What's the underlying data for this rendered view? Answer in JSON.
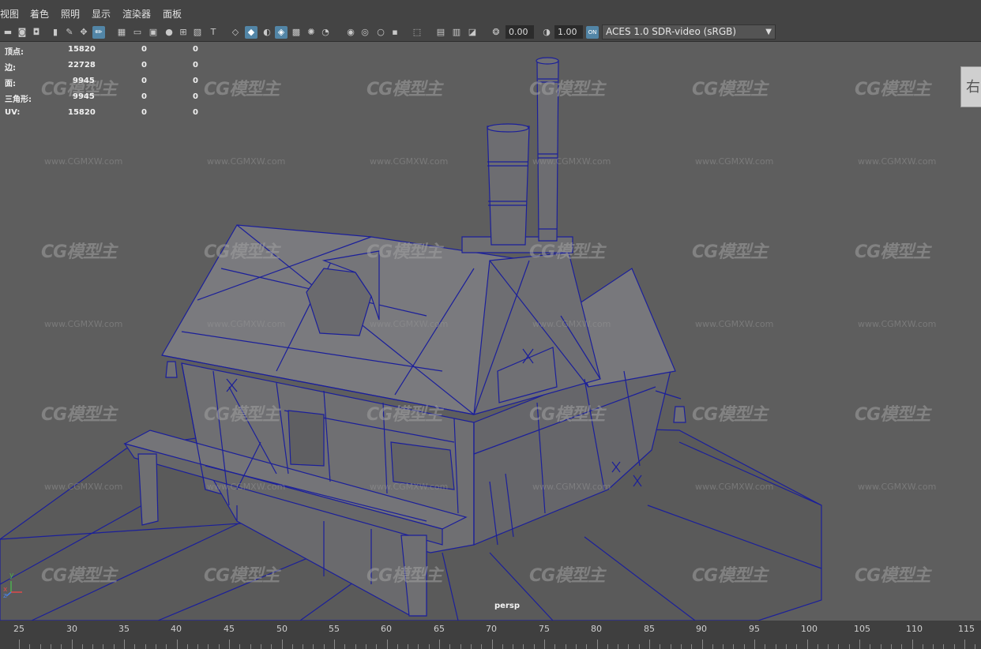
{
  "menu": [
    "视图",
    "着色",
    "照明",
    "显示",
    "渲染器",
    "面板"
  ],
  "toolbar": {
    "exposure_value": "0.00",
    "gamma_value": "1.00",
    "color_management_icon": "ON",
    "view_transform": "ACES 1.0 SDR-video (sRGB)"
  },
  "hud": {
    "rows": [
      {
        "label": "顶点:",
        "v1": "15820",
        "v2": "0",
        "v3": "0"
      },
      {
        "label": "边:",
        "v1": "22728",
        "v2": "0",
        "v3": "0"
      },
      {
        "label": "面:",
        "v1": "9945",
        "v2": "0",
        "v3": "0"
      },
      {
        "label": "三角形:",
        "v1": "9945",
        "v2": "0",
        "v3": "0"
      },
      {
        "label": "UV:",
        "v1": "15820",
        "v2": "0",
        "v3": "0"
      }
    ]
  },
  "viewport": {
    "camera_label": "persp",
    "viewcube_label": "右",
    "watermark_logo": "CG模型主",
    "watermark_url": "www.CGMXW.com",
    "axis_labels": {
      "y": "y",
      "x": "x",
      "z": "z"
    }
  },
  "timeline": {
    "ticks": [
      "25",
      "30",
      "35",
      "40",
      "45",
      "50",
      "55",
      "60",
      "65",
      "70",
      "75",
      "80",
      "85",
      "90",
      "95",
      "100",
      "105",
      "110",
      "115"
    ]
  },
  "colors": {
    "viewport_bg": "#5e5e5e",
    "wireframe": "#1b1f9a",
    "active_tool": "#5285a6",
    "menubar_bg": "#444444"
  }
}
